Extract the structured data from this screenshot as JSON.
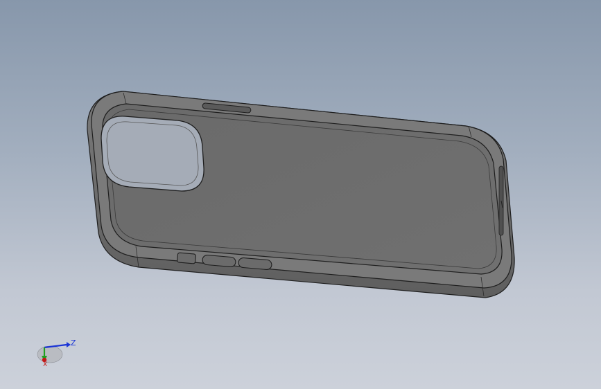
{
  "viewport": {
    "background_top": "#8797ab",
    "background_bottom": "#ccd1da"
  },
  "model": {
    "part": "phone-case",
    "shell_color": "#6f6f6f",
    "edge_color": "#1e1e1e",
    "rim_color": "#7c7c7c"
  },
  "triad": {
    "z_label": "Z",
    "x_label": "X",
    "z_color": "#1a34d6",
    "x_color": "#c41818",
    "y_color": "#1fa01f"
  }
}
